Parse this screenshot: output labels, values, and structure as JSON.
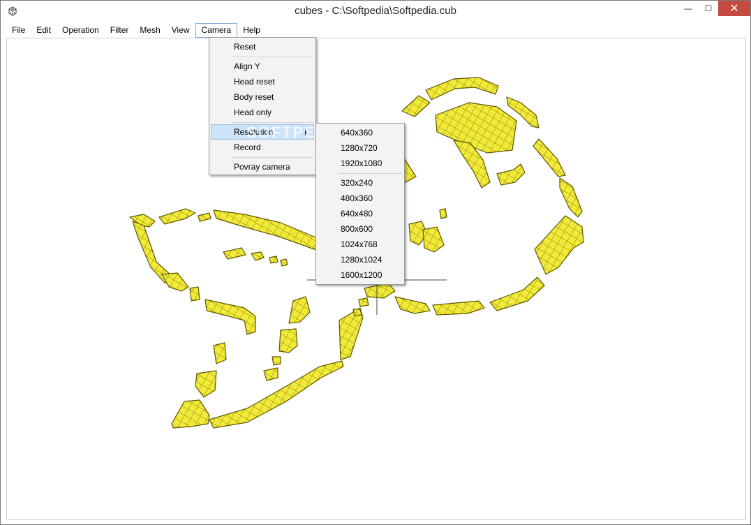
{
  "window": {
    "title": "cubes - C:\\Softpedia\\Softpedia.cub",
    "minimize": "—",
    "maximize": "☐",
    "close": "✕"
  },
  "menubar": [
    "File",
    "Edit",
    "Operation",
    "Filter",
    "Mesh",
    "View",
    "Camera",
    "Help"
  ],
  "camera_menu": {
    "items": [
      "Reset",
      "Align Y",
      "Head reset",
      "Body reset",
      "Head only",
      "Resolution",
      "Record",
      "Povray camera"
    ]
  },
  "resolution_menu": {
    "group1": [
      "640x360",
      "1280x720",
      "1920x1080"
    ],
    "group2": [
      "320x240",
      "480x360",
      "640x480",
      "800x600",
      "1024x768",
      "1280x1024",
      "1600x1200"
    ]
  },
  "watermark": "SOFTPEDIA",
  "colors": {
    "model_fill": "#f2ea3a",
    "model_edge": "#6b6400",
    "highlight": "#cde3f7"
  }
}
